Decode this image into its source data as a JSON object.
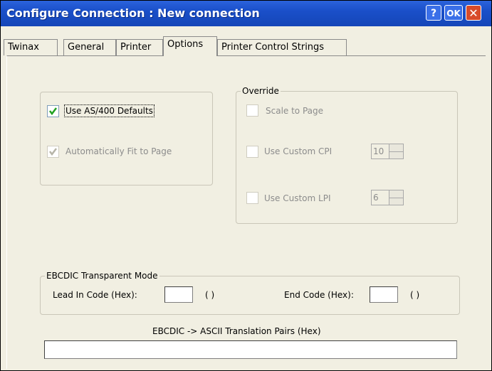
{
  "window": {
    "title": "Configure Connection : New connection",
    "help": "?",
    "ok": "OK",
    "close": "✕"
  },
  "tabs": [
    {
      "label": "Twinax"
    },
    {
      "label": "General"
    },
    {
      "label": "Printer"
    },
    {
      "label": "Options"
    },
    {
      "label": "Printer Control Strings"
    }
  ],
  "active_tab": "Options",
  "left_group": {
    "use_defaults": {
      "label": "Use AS/400 Defaults",
      "checked": true
    },
    "auto_fit": {
      "label": "Automatically Fit to Page",
      "checked": true,
      "disabled": true
    }
  },
  "override": {
    "title": "Override",
    "scale": {
      "label": "Scale to Page"
    },
    "cpi": {
      "label": "Use Custom CPI",
      "value": "10"
    },
    "lpi": {
      "label": "Use Custom LPI",
      "value": "6"
    }
  },
  "ebcdic": {
    "title": "EBCDIC Transparent Mode",
    "lead_label": "Lead In Code (Hex):",
    "lead_paren": "(    )",
    "end_label": "End Code (Hex):",
    "end_paren": "(    )"
  },
  "translation": {
    "label": "EBCDIC -> ASCII Translation Pairs (Hex)",
    "value": ""
  }
}
